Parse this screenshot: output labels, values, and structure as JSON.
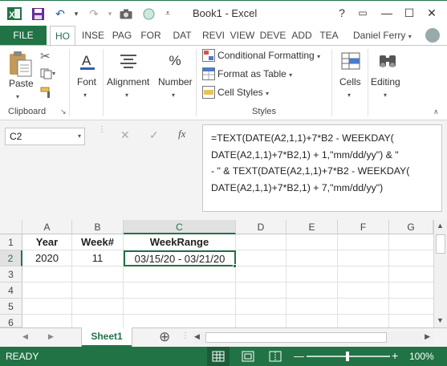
{
  "window": {
    "title": "Book1 - Excel",
    "controls": [
      "?",
      "▭",
      "—",
      "☐",
      "✕"
    ]
  },
  "ribbon_tabs": [
    "FILE",
    "HO",
    "INSE",
    "PAG",
    "FOR",
    "DAT",
    "REVI",
    "VIEW",
    "DEVE",
    "ADD",
    "TEA"
  ],
  "user": "Daniel Ferry",
  "ribbon": {
    "paste": "Paste",
    "clipboard": "Clipboard",
    "font": "Font",
    "alignment": "Alignment",
    "number": "Number",
    "number_icon": "%",
    "conditional_formatting": "Conditional Formatting",
    "format_as_table": "Format as Table",
    "cell_styles": "Cell Styles",
    "styles": "Styles",
    "cells": "Cells",
    "editing": "Editing"
  },
  "formula_bar": {
    "name_box": "C2",
    "fx": "fx",
    "formula_lines": [
      "=TEXT(DATE(A2,1,1)+7*B2 - WEEKDAY(",
      "DATE(A2,1,1)+7*B2,1) + 1,\"mm/dd/yy\") & \"",
      "- \" & TEXT(DATE(A2,1,1)+7*B2 - WEEKDAY(",
      "DATE(A2,1,1)+7*B2,1) + 7,\"mm/dd/yy\")"
    ]
  },
  "grid": {
    "columns": [
      "A",
      "B",
      "C",
      "D",
      "E",
      "F",
      "G"
    ],
    "rows": [
      "1",
      "2",
      "3",
      "4",
      "5",
      "6"
    ],
    "cells": {
      "A1": "Year",
      "B1": "Week#",
      "C1": "WeekRange",
      "A2": "2020",
      "B2": "11",
      "C2": "03/15/20 - 03/21/20"
    },
    "active_cell": "C2"
  },
  "sheet_tabs": {
    "active": "Sheet1",
    "add": "⊕"
  },
  "status": {
    "mode": "READY",
    "zoom": "100%",
    "zoom_minus": "—",
    "zoom_plus": "+"
  },
  "colors": {
    "excel_green": "#217346"
  }
}
